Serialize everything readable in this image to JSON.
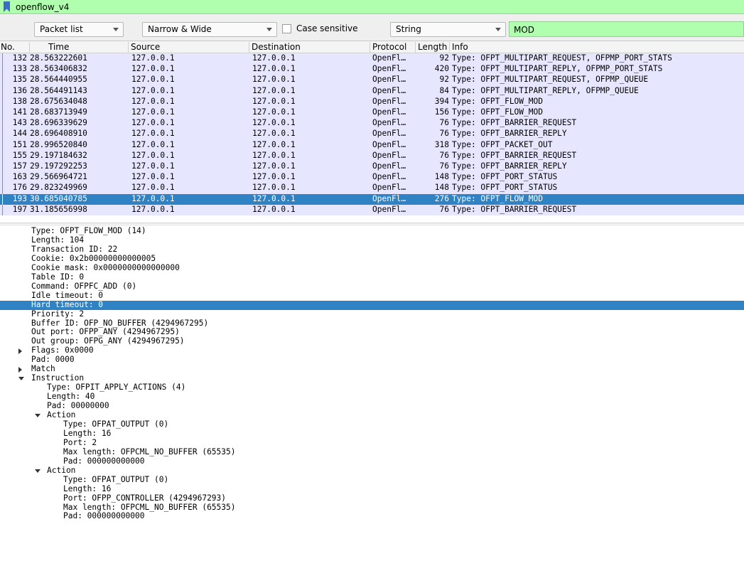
{
  "filter_bar": {
    "text": "openflow_v4",
    "color": "#afffaf"
  },
  "find_toolbar": {
    "display_target": "Packet list",
    "char_width": "Narrow & Wide",
    "case_sensitive_label": "Case sensitive",
    "search_type": "String",
    "search_value": "MOD"
  },
  "columns": [
    "No.",
    "Time",
    "Source",
    "Destination",
    "Protocol",
    "Length",
    "Info"
  ],
  "packets": [
    {
      "no": "132",
      "time": "28.563222601",
      "src": "127.0.0.1",
      "dst": "127.0.0.1",
      "proto": "OpenFl…",
      "len": "92",
      "info": "Type: OFPT_MULTIPART_REQUEST, OFPMP_PORT_STATS"
    },
    {
      "no": "133",
      "time": "28.563406832",
      "src": "127.0.0.1",
      "dst": "127.0.0.1",
      "proto": "OpenFl…",
      "len": "420",
      "info": "Type: OFPT_MULTIPART_REPLY, OFPMP_PORT_STATS"
    },
    {
      "no": "135",
      "time": "28.564440955",
      "src": "127.0.0.1",
      "dst": "127.0.0.1",
      "proto": "OpenFl…",
      "len": "92",
      "info": "Type: OFPT_MULTIPART_REQUEST, OFPMP_QUEUE"
    },
    {
      "no": "136",
      "time": "28.564491143",
      "src": "127.0.0.1",
      "dst": "127.0.0.1",
      "proto": "OpenFl…",
      "len": "84",
      "info": "Type: OFPT_MULTIPART_REPLY, OFPMP_QUEUE"
    },
    {
      "no": "138",
      "time": "28.675634048",
      "src": "127.0.0.1",
      "dst": "127.0.0.1",
      "proto": "OpenFl…",
      "len": "394",
      "info": "Type: OFPT_FLOW_MOD"
    },
    {
      "no": "141",
      "time": "28.683713949",
      "src": "127.0.0.1",
      "dst": "127.0.0.1",
      "proto": "OpenFl…",
      "len": "156",
      "info": "Type: OFPT_FLOW_MOD"
    },
    {
      "no": "143",
      "time": "28.696339629",
      "src": "127.0.0.1",
      "dst": "127.0.0.1",
      "proto": "OpenFl…",
      "len": "76",
      "info": "Type: OFPT_BARRIER_REQUEST"
    },
    {
      "no": "144",
      "time": "28.696408910",
      "src": "127.0.0.1",
      "dst": "127.0.0.1",
      "proto": "OpenFl…",
      "len": "76",
      "info": "Type: OFPT_BARRIER_REPLY"
    },
    {
      "no": "151",
      "time": "28.996520840",
      "src": "127.0.0.1",
      "dst": "127.0.0.1",
      "proto": "OpenFl…",
      "len": "318",
      "info": "Type: OFPT_PACKET_OUT"
    },
    {
      "no": "155",
      "time": "29.197184632",
      "src": "127.0.0.1",
      "dst": "127.0.0.1",
      "proto": "OpenFl…",
      "len": "76",
      "info": "Type: OFPT_BARRIER_REQUEST"
    },
    {
      "no": "157",
      "time": "29.197292253",
      "src": "127.0.0.1",
      "dst": "127.0.0.1",
      "proto": "OpenFl…",
      "len": "76",
      "info": "Type: OFPT_BARRIER_REPLY"
    },
    {
      "no": "163",
      "time": "29.566964721",
      "src": "127.0.0.1",
      "dst": "127.0.0.1",
      "proto": "OpenFl…",
      "len": "148",
      "info": "Type: OFPT_PORT_STATUS"
    },
    {
      "no": "176",
      "time": "29.823249969",
      "src": "127.0.0.1",
      "dst": "127.0.0.1",
      "proto": "OpenFl…",
      "len": "148",
      "info": "Type: OFPT_PORT_STATUS"
    },
    {
      "no": "193",
      "time": "30.685040785",
      "src": "127.0.0.1",
      "dst": "127.0.0.1",
      "proto": "OpenFl…",
      "len": "276",
      "info": "Type: OFPT_FLOW_MOD",
      "selected": true
    },
    {
      "no": "197",
      "time": "31.185656998",
      "src": "127.0.0.1",
      "dst": "127.0.0.1",
      "proto": "OpenFl…",
      "len": "76",
      "info": "Type: OFPT_BARRIER_REQUEST"
    }
  ],
  "details": [
    {
      "indent": 0,
      "text": "Type: OFPT_FLOW_MOD (14)"
    },
    {
      "indent": 0,
      "text": "Length: 104"
    },
    {
      "indent": 0,
      "text": "Transaction ID: 22"
    },
    {
      "indent": 0,
      "text": "Cookie: 0x2b00000000000005"
    },
    {
      "indent": 0,
      "text": "Cookie mask: 0x0000000000000000"
    },
    {
      "indent": 0,
      "text": "Table ID: 0"
    },
    {
      "indent": 0,
      "text": "Command: OFPFC_ADD (0)"
    },
    {
      "indent": 0,
      "text": "Idle timeout: 0"
    },
    {
      "indent": 0,
      "text": "Hard timeout: 0",
      "selected": true
    },
    {
      "indent": 0,
      "text": "Priority: 2"
    },
    {
      "indent": 0,
      "text": "Buffer ID: OFP_NO_BUFFER (4294967295)"
    },
    {
      "indent": 0,
      "text": "Out port: OFPP_ANY (4294967295)"
    },
    {
      "indent": 0,
      "text": "Out group: OFPG_ANY (4294967295)"
    },
    {
      "indent": 0,
      "text": "Flags: 0x0000",
      "toggle": "closed"
    },
    {
      "indent": 0,
      "text": "Pad: 0000"
    },
    {
      "indent": 0,
      "text": "Match",
      "toggle": "closed"
    },
    {
      "indent": 0,
      "text": "Instruction",
      "toggle": "open"
    },
    {
      "indent": 1,
      "text": "Type: OFPIT_APPLY_ACTIONS (4)"
    },
    {
      "indent": 1,
      "text": "Length: 40"
    },
    {
      "indent": 1,
      "text": "Pad: 00000000"
    },
    {
      "indent": 1,
      "text": "Action",
      "toggle": "open"
    },
    {
      "indent": 2,
      "text": "Type: OFPAT_OUTPUT (0)"
    },
    {
      "indent": 2,
      "text": "Length: 16"
    },
    {
      "indent": 2,
      "text": "Port: 2"
    },
    {
      "indent": 2,
      "text": "Max length: OFPCML_NO_BUFFER (65535)"
    },
    {
      "indent": 2,
      "text": "Pad: 000000000000"
    },
    {
      "indent": 1,
      "text": "Action",
      "toggle": "open"
    },
    {
      "indent": 2,
      "text": "Type: OFPAT_OUTPUT (0)"
    },
    {
      "indent": 2,
      "text": "Length: 16"
    },
    {
      "indent": 2,
      "text": "Port: OFPP_CONTROLLER (4294967293)"
    },
    {
      "indent": 2,
      "text": "Max length: OFPCML_NO_BUFFER (65535)"
    },
    {
      "indent": 2,
      "text": "Pad: 000000000000"
    }
  ],
  "colors": {
    "row_bg": "#e7e6ff",
    "selection": "#2f82c4",
    "filter_ok": "#afffaf"
  }
}
